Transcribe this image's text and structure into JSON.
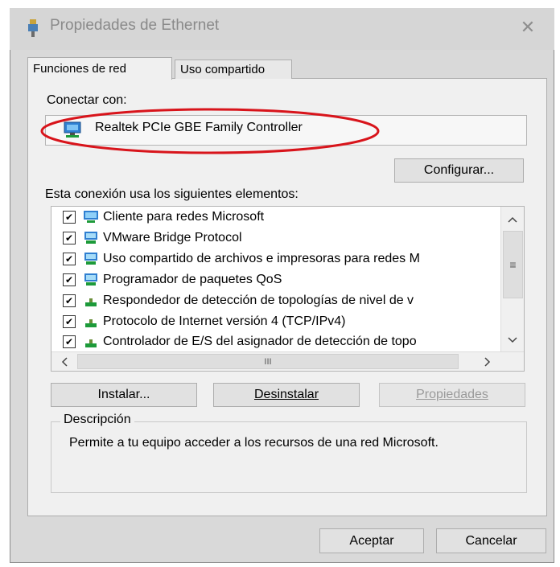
{
  "window": {
    "title": "Propiedades de Ethernet",
    "close_label": "✕"
  },
  "tabs": [
    {
      "label": "Funciones de red"
    },
    {
      "label": "Uso compartido"
    }
  ],
  "connect": {
    "label": "Conectar con:",
    "device_name": "Realtek PCIe GBE Family Controller",
    "configure_button": "Configurar..."
  },
  "elements": {
    "label": "Esta conexión usa los siguientes elementos:",
    "items": [
      {
        "label": "Cliente para redes Microsoft",
        "checked": true,
        "icon": "network-client-icon"
      },
      {
        "label": "VMware Bridge Protocol",
        "checked": true,
        "icon": "network-service-icon"
      },
      {
        "label": "Uso compartido de archivos e impresoras para redes M",
        "checked": true,
        "icon": "network-service-icon"
      },
      {
        "label": "Programador de paquetes QoS",
        "checked": true,
        "icon": "network-service-icon"
      },
      {
        "label": "Respondedor de detección de topologías de nivel de v",
        "checked": true,
        "icon": "network-protocol-icon"
      },
      {
        "label": "Protocolo de Internet versión 4 (TCP/IPv4)",
        "checked": true,
        "icon": "network-protocol-icon"
      },
      {
        "label": "Controlador de E/S del asignador de detección de topo",
        "checked": true,
        "icon": "network-protocol-icon"
      }
    ],
    "hscroll_thumb_glyph": "III"
  },
  "actions": {
    "install": "Instalar...",
    "uninstall": "Desinstalar",
    "properties": "Propiedades"
  },
  "description": {
    "legend": "Descripción",
    "text": "Permite a tu equipo acceder a los recursos de una red Microsoft."
  },
  "footer": {
    "accept": "Aceptar",
    "cancel": "Cancelar"
  },
  "colors": {
    "annotation_circle": "#d8141b",
    "accent_blue": "#2f7fd1",
    "protocol_green": "#1d9a3a"
  }
}
